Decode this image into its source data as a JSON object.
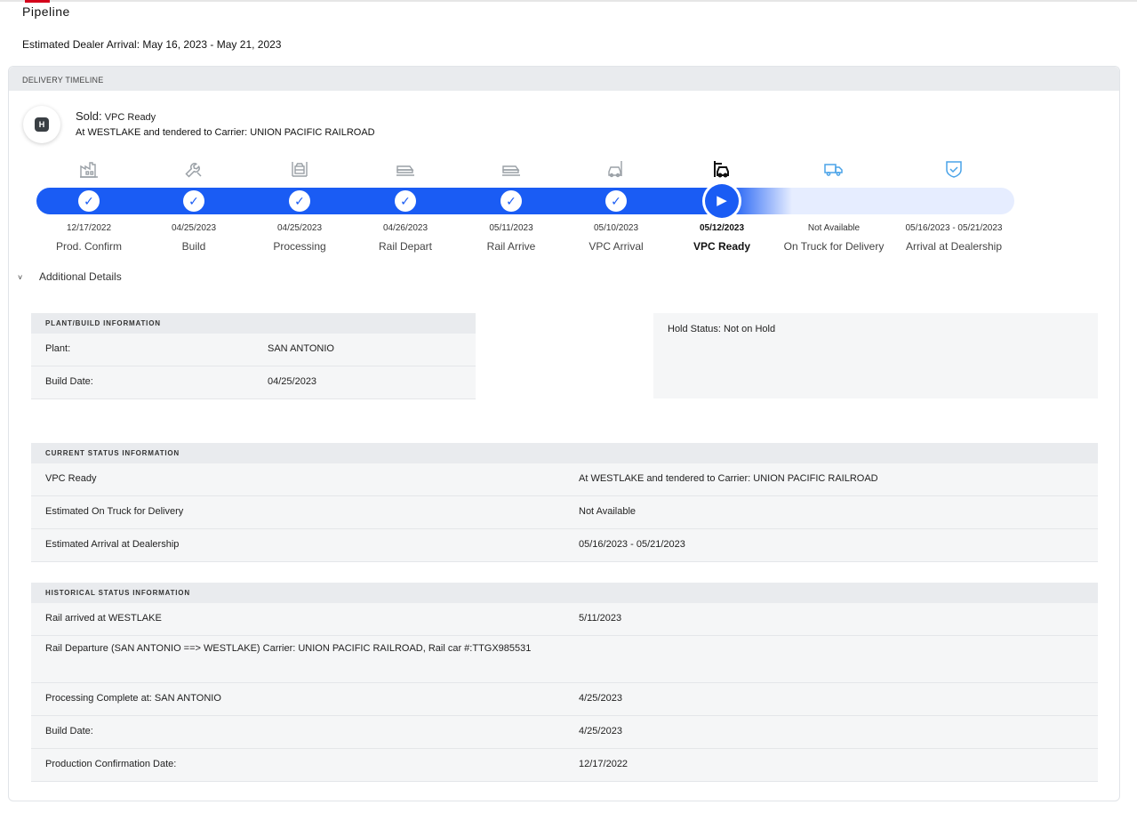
{
  "page": {
    "title": "Pipeline",
    "estimated_arrival": "Estimated Dealer Arrival: May 16, 2023 - May 21, 2023"
  },
  "timeline": {
    "header": "DELIVERY TIMELINE",
    "avatar_letter": "H",
    "status_label": "Sold:",
    "status_value": "VPC Ready",
    "location": "At WESTLAKE and tendered to Carrier: UNION PACIFIC RAILROAD",
    "progress_fraction": 0.74,
    "steps": [
      {
        "date": "12/17/2022",
        "label": "Prod. Confirm",
        "state": "complete",
        "icon": "factory-icon"
      },
      {
        "date": "04/25/2023",
        "label": "Build",
        "state": "complete",
        "icon": "wrench-icon"
      },
      {
        "date": "04/25/2023",
        "label": "Processing",
        "state": "complete",
        "icon": "processing-icon"
      },
      {
        "date": "04/26/2023",
        "label": "Rail Depart",
        "state": "complete",
        "icon": "rail-depart-icon"
      },
      {
        "date": "05/11/2023",
        "label": "Rail Arrive",
        "state": "complete",
        "icon": "rail-arrive-icon"
      },
      {
        "date": "05/10/2023",
        "label": "VPC Arrival",
        "state": "complete",
        "icon": "vpc-arrival-icon"
      },
      {
        "date": "05/12/2023",
        "label": "VPC Ready",
        "state": "current",
        "icon": "vpc-ready-icon"
      },
      {
        "date": "Not Available",
        "label": "On Truck for Delivery",
        "state": "pending",
        "icon": "truck-icon"
      },
      {
        "date": "05/16/2023 - 05/21/2023",
        "label": "Arrival at Dealership",
        "state": "pending",
        "icon": "shield-check-icon"
      }
    ],
    "additional_details": "Additional Details"
  },
  "plant": {
    "header": "PLANT/BUILD INFORMATION",
    "rows": [
      {
        "key": "Plant:",
        "value": "SAN ANTONIO"
      },
      {
        "key": "Build Date:",
        "value": "04/25/2023"
      }
    ]
  },
  "hold": {
    "status": "Hold Status: Not on Hold"
  },
  "current": {
    "header": "CURRENT STATUS INFORMATION",
    "rows": [
      {
        "key": "VPC Ready",
        "value": "At WESTLAKE and tendered to Carrier: UNION PACIFIC RAILROAD"
      },
      {
        "key": "Estimated On Truck for Delivery",
        "value": "Not Available"
      },
      {
        "key": "Estimated Arrival at Dealership",
        "value": "05/16/2023 - 05/21/2023"
      }
    ]
  },
  "historical": {
    "header": "HISTORICAL STATUS INFORMATION",
    "rows": [
      {
        "key": "Rail arrived at WESTLAKE",
        "value": "5/11/2023"
      },
      {
        "key": "Rail Departure (SAN ANTONIO ==> WESTLAKE) Carrier: UNION PACIFIC RAILROAD, Rail car #:TTGX985531",
        "value": ""
      },
      {
        "key": "Processing Complete at: SAN ANTONIO",
        "value": "4/25/2023"
      },
      {
        "key": "Build Date:",
        "value": "4/25/2023"
      },
      {
        "key": "Production Confirmation Date:",
        "value": "12/17/2022"
      }
    ]
  },
  "colors": {
    "progress": "#1a5cf4",
    "progress_pending": "#e6edff",
    "header_bg": "#e9ebee",
    "card_bg": "#f5f6f7",
    "brand": "#d4001a"
  }
}
